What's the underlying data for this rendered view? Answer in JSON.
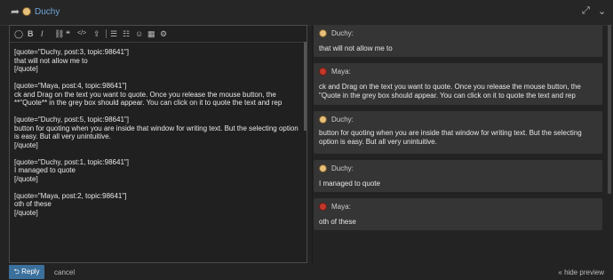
{
  "header": {
    "reply_icon": "reply-arrow-icon",
    "user": "Duchy",
    "expand_icon": "expand-icon",
    "collapse_icon": "chevron-down-icon"
  },
  "toolbar": {
    "buttons": [
      "speech-bubble",
      "bold",
      "italic",
      "link",
      "quote",
      "code",
      "upload",
      "bullet-list",
      "numbered-list",
      "emoji",
      "date",
      "settings"
    ],
    "glyphs": [
      "◯",
      "B",
      "I",
      "⛓",
      "❝",
      "</>",
      "⇪",
      "☰",
      "☷",
      "☺",
      "▦",
      "⚙"
    ]
  },
  "editor": {
    "content": "[quote=\"Duchy, post:3, topic:98641\"]\nthat will not allow me to\n[/quote]\n\n[quote=\"Maya, post:4, topic:98641\"]\nck and Drag on the text you want to quote. Once you release the mouse button, the **\"Quote** in the grey box should appear. You can click on it to quote the text and rep\n\n[quote=\"Duchy, post:5, topic:98641\"]\nbutton for quoting when you are inside that window for writing text. But the selecting option is easy. But all very unintuitive.\n[/quote]\n\n[quote=\"Duchy, post:1, topic:98641\"]\nI managed to quote\n[/quote]\n\n[quote=\"Maya, post:2, topic:98641\"]\noth of these\n[/quote]"
  },
  "preview": [
    {
      "user": "Duchy:",
      "avatar": "duchy",
      "text": "that will not allow me to"
    },
    {
      "user": "Maya:",
      "avatar": "maya",
      "text": "ck and Drag on the text you want to quote. Once you release the mouse button, the \"Quote in the grey box should appear. You can click on it to quote the text and rep"
    },
    {
      "user": "Duchy:",
      "avatar": "duchy",
      "text": "button for quoting when you are inside that window for writing text. But the selecting option is easy. But all very unintuitive."
    },
    {
      "user": "Duchy:",
      "avatar": "duchy",
      "text": "I managed to quote"
    },
    {
      "user": "Maya:",
      "avatar": "maya",
      "text": "oth of these"
    }
  ],
  "footer": {
    "reply_label": "Reply",
    "cancel_label": "cancel",
    "hide_preview_label": "« hide preview"
  },
  "colors": {
    "accent": "#3b6f9c",
    "username": "#6fa5d8",
    "background": "#232323",
    "card": "#353535"
  }
}
